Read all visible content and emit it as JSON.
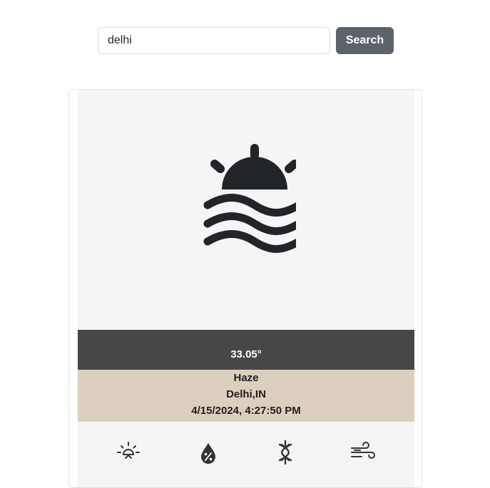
{
  "search": {
    "value": "delhi",
    "placeholder": "",
    "button_label": "Search"
  },
  "weather": {
    "icon": "sunrise-waves-icon",
    "temperature": "33.05°",
    "condition": "Haze",
    "location": "Delhi,IN",
    "datetime": "4/15/2024, 4:27:50 PM"
  },
  "detail_icons": [
    {
      "icon": "sunrise-icon"
    },
    {
      "icon": "humidity-icon"
    },
    {
      "icon": "pressure-icon"
    },
    {
      "icon": "wind-icon"
    }
  ],
  "colors": {
    "hero_bg": "#f5f5f5",
    "temp_band": "#474746",
    "info_band": "#dccfc0",
    "button": "#5c636a"
  }
}
